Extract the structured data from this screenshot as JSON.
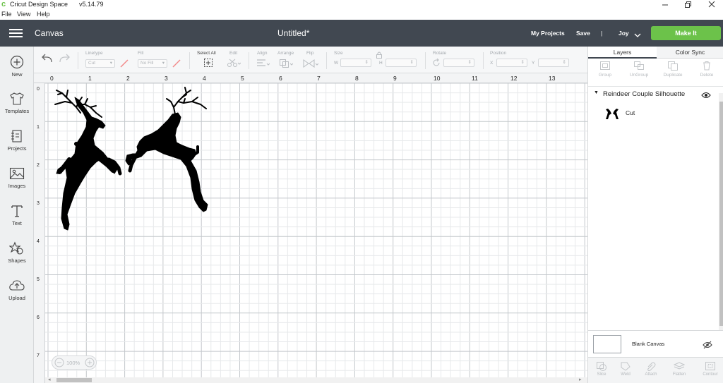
{
  "window": {
    "app_title": "Cricut Design Space",
    "version": "v5.14.79"
  },
  "menu": [
    "File",
    "View",
    "Help"
  ],
  "header": {
    "section_title": "Canvas",
    "doc_title": "Untitled*",
    "my_projects": "My Projects",
    "save": "Save",
    "separator": "|",
    "user": "Joy",
    "make_it": "Make It",
    "accent_color": "#6cc24a",
    "bar_color": "#414851"
  },
  "nav": [
    {
      "label": "New",
      "icon": "plus-circle-icon"
    },
    {
      "label": "Templates",
      "icon": "tshirt-icon"
    },
    {
      "label": "Projects",
      "icon": "projects-icon"
    },
    {
      "label": "Images",
      "icon": "image-icon"
    },
    {
      "label": "Text",
      "icon": "text-icon"
    },
    {
      "label": "Shapes",
      "icon": "shapes-icon"
    },
    {
      "label": "Upload",
      "icon": "upload-cloud-icon"
    }
  ],
  "toolbar": {
    "linetype_label": "Linetype",
    "linetype_value": "Cut",
    "fill_label": "Fill",
    "fill_value": "No Fill",
    "select_all": "Select All",
    "edit": "Edit",
    "align": "Align",
    "arrange": "Arrange",
    "flip": "Flip",
    "size": "Size",
    "w": "W",
    "h": "H",
    "rotate": "Rotate",
    "position": "Position",
    "x": "X",
    "y": "Y"
  },
  "ruler": {
    "top": [
      "0",
      "1",
      "2",
      "3",
      "4",
      "5",
      "6",
      "7",
      "8",
      "9",
      "10",
      "11",
      "12",
      "13"
    ],
    "left": [
      "0",
      "1",
      "2",
      "3",
      "4",
      "5",
      "6",
      "7"
    ]
  },
  "zoom": {
    "value": "100%"
  },
  "panel": {
    "tab_layers": "Layers",
    "tab_color_sync": "Color Sync",
    "tools_top": [
      "Group",
      "UnGroup",
      "Duplicate",
      "Delete"
    ],
    "group_name": "Reindeer Couple Silhouette",
    "layer_name": "Cut",
    "blank_canvas": "Blank Canvas",
    "tools_bottom": [
      "Slice",
      "Weld",
      "Attach",
      "Flatten",
      "Contour"
    ]
  }
}
